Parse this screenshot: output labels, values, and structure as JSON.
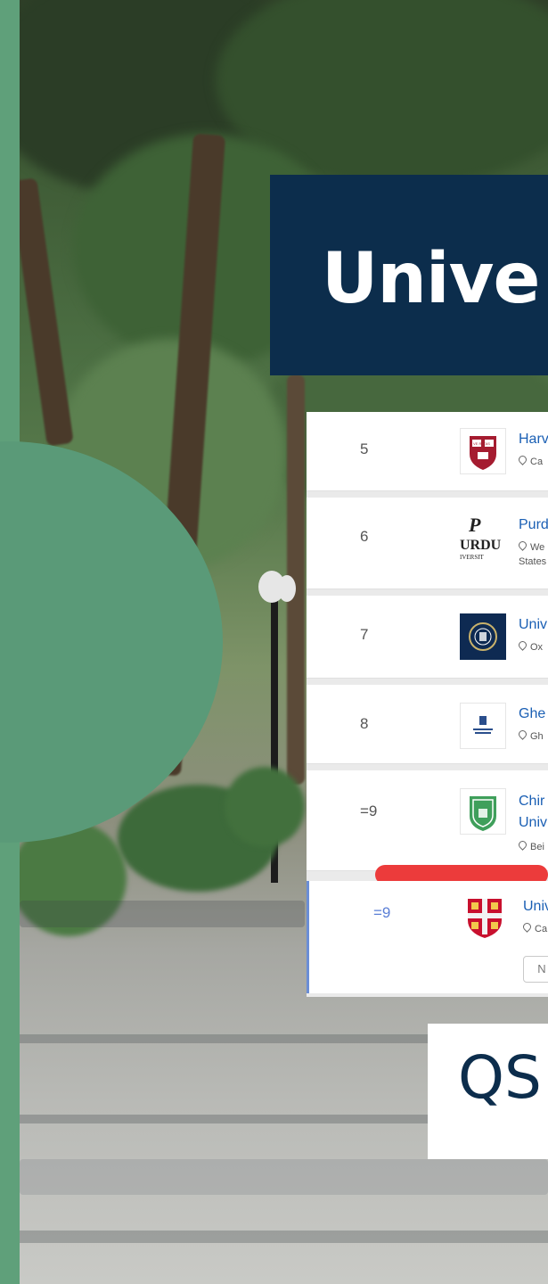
{
  "title": "Unive",
  "footer_text": "QS",
  "rows": [
    {
      "rank": "5",
      "name": "Harv",
      "location": "Ca",
      "location2": ""
    },
    {
      "rank": "6",
      "name": "Purd",
      "location": "We",
      "location2": "States"
    },
    {
      "rank": "7",
      "name": "Univ",
      "location": "Ox",
      "location2": ""
    },
    {
      "rank": "8",
      "name": "Ghe",
      "location": "Gh",
      "location2": ""
    },
    {
      "rank": "=9",
      "name": "Chir",
      "name2": "Univ",
      "location": "Bei",
      "location2": ""
    },
    {
      "rank": "=9",
      "name": "Univ",
      "location": "Ca",
      "button": "N"
    }
  ],
  "logos": {
    "row5": "VE RI TAS",
    "row6_top": "P",
    "row6_mid": "URDU",
    "row6_bottom": "IVERSIT"
  },
  "colors": {
    "accent_green": "#5a9a78",
    "navy": "#0c2d4c",
    "link_blue": "#1a5fb4",
    "red": "#ec3b3b",
    "highlight_border": "#6b8ed6"
  }
}
